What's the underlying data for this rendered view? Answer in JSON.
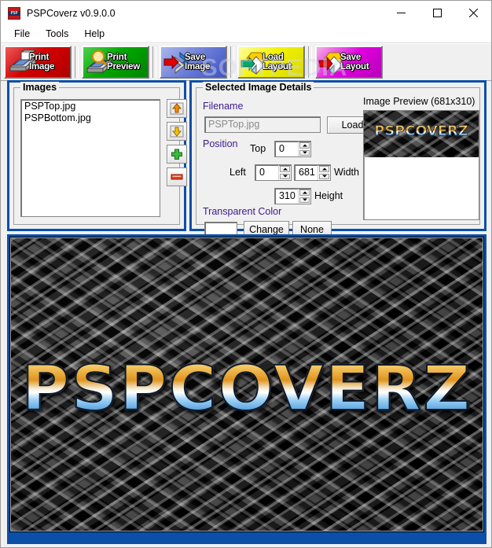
{
  "window": {
    "title": "PSPCoverz v0.9.0.0",
    "icon": "app-icon",
    "minimize_label": "Minimize",
    "maximize_label": "Maximize",
    "close_label": "Close"
  },
  "menu": {
    "items": [
      {
        "label": "File"
      },
      {
        "label": "Tools"
      },
      {
        "label": "Help"
      }
    ]
  },
  "toolbar": {
    "watermark": "SOFTPEDIA",
    "buttons": [
      {
        "line1": "Print",
        "line2": "Image",
        "icon": "printer-icon",
        "color": "#d40000"
      },
      {
        "line1": "Print",
        "line2": "Preview",
        "icon": "print-preview-icon",
        "color": "#00a800"
      },
      {
        "line1": "Save",
        "line2": "Image",
        "icon": "save-image-icon",
        "color": "#3f52bf"
      },
      {
        "line1": "Load",
        "line2": "Layout",
        "icon": "load-layout-icon",
        "color": "#f2f200"
      },
      {
        "line1": "Save",
        "line2": "Layout",
        "icon": "save-layout-icon",
        "color": "#e000e0"
      }
    ]
  },
  "images_panel": {
    "title": "Images",
    "items": [
      {
        "label": "PSPTop.jpg"
      },
      {
        "label": "PSPBottom.jpg"
      }
    ],
    "side_buttons": [
      {
        "name": "move-up-button",
        "icon": "arrow-up-icon"
      },
      {
        "name": "move-down-button",
        "icon": "arrow-down-icon"
      },
      {
        "name": "add-image-button",
        "icon": "plus-icon"
      },
      {
        "name": "remove-image-button",
        "icon": "minus-icon"
      }
    ]
  },
  "details_panel": {
    "title": "Selected Image Details",
    "filename_label": "Filename",
    "filename_value": "PSPTop.jpg",
    "load_button": "Load",
    "position_label": "Position",
    "top_label": "Top",
    "top_value": "0",
    "left_label": "Left",
    "left_value": "0",
    "width_label": "Width",
    "width_value": "681",
    "height_label": "Height",
    "height_value": "310",
    "transparent_color_label": "Transparent Color",
    "transparent_color_value": "#ffffff",
    "change_button": "Change",
    "none_button": "None"
  },
  "preview": {
    "title": "Image Preview (681x310)",
    "logo_text": "PSPCOVERZ"
  },
  "canvas": {
    "logo_text": "PSPCOVERZ"
  },
  "colors": {
    "panel_border": "#0b4fa8",
    "label_purple": "#3b1a8c",
    "accent_gold": "#e0941c",
    "accent_blue": "#3c8fd6"
  }
}
